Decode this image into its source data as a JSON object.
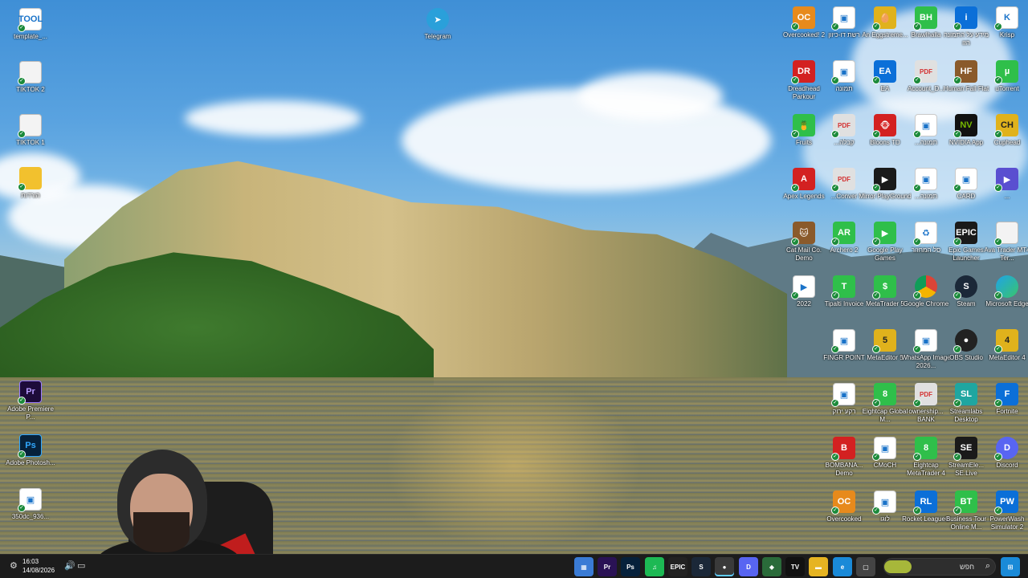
{
  "left_icons": [
    {
      "label": "template_...",
      "icon": "tool-icon",
      "glyph": "TOOL",
      "style": "g-doc"
    },
    {
      "label": "TIKTOK 2",
      "icon": "text-file-icon",
      "glyph": "",
      "style": "g-file"
    },
    {
      "label": "TIKTOK 1",
      "icon": "text-file-icon",
      "glyph": "",
      "style": "g-file"
    },
    {
      "label": "הורדות",
      "icon": "folder-icon",
      "glyph": "",
      "style": "g-folder"
    },
    {
      "label": "Adobe Premiere P...",
      "icon": "premiere-icon",
      "glyph": "Pr",
      "style": "g-pr"
    },
    {
      "label": "Adobe Photosh...",
      "icon": "photoshop-icon",
      "glyph": "Ps",
      "style": "g-ps"
    },
    {
      "label": "350dc_936...",
      "icon": "image-file-icon",
      "glyph": "▣",
      "style": "g-doc"
    }
  ],
  "telegram": {
    "label": "Telegram",
    "glyph": "➤"
  },
  "right_icons": [
    [
      {
        "label": "Overcooked! 2",
        "glyph": "OC",
        "style": "g-orange",
        "icon": "overcooked-icon"
      },
      {
        "label": "רשת דו-כיוון",
        "glyph": "▣",
        "style": "g-doc",
        "icon": "image-file-icon"
      },
      {
        "label": "An Eggstreme...",
        "glyph": "🥚",
        "style": "g-yellow",
        "icon": "egg-game-icon"
      },
      {
        "label": "Brawlhalla",
        "glyph": "BH",
        "style": "g-green",
        "icon": "brawlhalla-icon"
      },
      {
        "label": "מידע על התמונה הזו",
        "glyph": "i",
        "style": "g-blue",
        "icon": "info-icon"
      },
      {
        "label": "Krisp",
        "glyph": "K",
        "style": "g-doc",
        "icon": "krisp-icon"
      }
    ],
    [
      {
        "label": "Dreadhead Parkour",
        "glyph": "DR",
        "style": "g-red",
        "icon": "dreadhead-icon"
      },
      {
        "label": "תמונה",
        "glyph": "▣",
        "style": "g-doc",
        "icon": "image-file-icon"
      },
      {
        "label": "EA",
        "glyph": "EA",
        "style": "g-blue",
        "icon": "ea-icon"
      },
      {
        "label": "Account_D...",
        "glyph": "PDF",
        "style": "g-pdf",
        "icon": "pdf-icon"
      },
      {
        "label": "Human Fall Flat",
        "glyph": "HF",
        "style": "g-brown",
        "icon": "human-fall-flat-icon"
      },
      {
        "label": "uTorrent",
        "glyph": "µ",
        "style": "g-green",
        "icon": "utorrent-icon"
      }
    ],
    [
      {
        "label": "Fruits",
        "glyph": "🍍",
        "style": "g-green",
        "icon": "fruits-game-icon"
      },
      {
        "label": "...קבלה",
        "glyph": "PDF",
        "style": "g-pdf",
        "icon": "pdf-icon"
      },
      {
        "label": "Bloons TD",
        "glyph": "🐵",
        "style": "g-red",
        "icon": "bloons-icon"
      },
      {
        "label": "...תמונה",
        "glyph": "▣",
        "style": "g-doc",
        "icon": "image-file-icon"
      },
      {
        "label": "NVIDIA App",
        "glyph": "NV",
        "style": "g-nvidia",
        "icon": "nvidia-icon"
      },
      {
        "label": "Cuphead",
        "glyph": "CH",
        "style": "g-yellow",
        "icon": "cuphead-icon"
      }
    ],
    [
      {
        "label": "Apex Legends",
        "glyph": "A",
        "style": "g-red",
        "icon": "apex-icon"
      },
      {
        "label": "...Conver",
        "glyph": "PDF",
        "style": "g-pdf",
        "icon": "pdf-icon"
      },
      {
        "label": "Mirror PlayGround",
        "glyph": "▶",
        "style": "g-dark",
        "icon": "mirror-icon"
      },
      {
        "label": "...תמונה",
        "glyph": "▣",
        "style": "g-doc",
        "icon": "image-file-icon"
      },
      {
        "label": "CARD",
        "glyph": "▣",
        "style": "g-doc",
        "icon": "image-file-icon"
      },
      {
        "label": "...",
        "glyph": "▶",
        "style": "g-purple",
        "icon": "media-player-icon"
      }
    ],
    [
      {
        "label": "Cat Mail Co. Demo",
        "glyph": "🐱",
        "style": "g-brown",
        "icon": "cat-mail-icon"
      },
      {
        "label": "Archero 2",
        "glyph": "AR",
        "style": "g-green",
        "icon": "archero-icon"
      },
      {
        "label": "Google Play Games",
        "glyph": "▶",
        "style": "g-green",
        "icon": "google-play-icon"
      },
      {
        "label": "סל המחזור",
        "glyph": "♻",
        "style": "g-doc",
        "icon": "recycle-bin-icon"
      },
      {
        "label": "Epic Games Launcher",
        "glyph": "EPIC",
        "style": "g-dark",
        "icon": "epic-games-icon"
      },
      {
        "label": "Ava Trader MT4 Ter...",
        "glyph": "",
        "style": "g-file",
        "icon": "text-file-icon"
      }
    ],
    [
      {
        "label": "2022",
        "glyph": "▶",
        "style": "g-doc",
        "icon": "video-file-icon"
      },
      {
        "label": "Tipalti Invoice",
        "glyph": "T",
        "style": "g-green",
        "icon": "tipalti-icon"
      },
      {
        "label": "MetaTrader 5",
        "glyph": "$",
        "style": "g-green",
        "icon": "metatrader-icon"
      },
      {
        "label": "Google Chrome",
        "glyph": "",
        "style": "g-chrome",
        "icon": "chrome-icon"
      },
      {
        "label": "Steam",
        "glyph": "S",
        "style": "g-steam",
        "icon": "steam-icon"
      },
      {
        "label": "Microsoft Edge",
        "glyph": "",
        "style": "g-edge",
        "icon": "edge-icon"
      }
    ],
    [
      {
        "label": "FINGR POINT",
        "glyph": "▣",
        "style": "g-doc",
        "icon": "image-file-icon"
      },
      {
        "label": "MetaEditor 5",
        "glyph": "5",
        "style": "g-yellow",
        "icon": "metaeditor-icon"
      },
      {
        "label": "WhatsApp Image 2026...",
        "glyph": "▣",
        "style": "g-doc",
        "icon": "image-file-icon"
      },
      {
        "label": "OBS Studio",
        "glyph": "●",
        "style": "g-obs",
        "icon": "obs-icon"
      },
      {
        "label": "MetaEditor 4",
        "glyph": "4",
        "style": "g-yellow",
        "icon": "metaeditor-icon"
      }
    ],
    [
      {
        "label": "רקע ירוק",
        "glyph": "▣",
        "style": "g-doc",
        "icon": "image-file-icon"
      },
      {
        "label": "Eightcap Global M...",
        "glyph": "8",
        "style": "g-green",
        "icon": "eightcap-icon"
      },
      {
        "label": "ownership... BANK",
        "glyph": "PDF",
        "style": "g-pdf",
        "icon": "pdf-icon"
      },
      {
        "label": "Streamlabs Desktop",
        "glyph": "SL",
        "style": "g-cyan",
        "icon": "streamlabs-icon"
      },
      {
        "label": "Fortnite",
        "glyph": "F",
        "style": "g-blue",
        "icon": "fortnite-icon"
      }
    ],
    [
      {
        "label": "BOMBANA... Demo",
        "glyph": "B",
        "style": "g-red",
        "icon": "bombana-icon"
      },
      {
        "label": "CMoCH",
        "glyph": "▣",
        "style": "g-doc",
        "icon": "image-file-icon"
      },
      {
        "label": "Eightcap MetaTrader 4",
        "glyph": "8",
        "style": "g-green",
        "icon": "eightcap-icon"
      },
      {
        "label": "StreamEle... SE.Live",
        "glyph": "SE",
        "style": "g-dark",
        "icon": "streamelements-icon"
      },
      {
        "label": "Discord",
        "glyph": "D",
        "style": "g-discord",
        "icon": "discord-icon"
      }
    ],
    [
      {
        "label": "Overcooked",
        "glyph": "OC",
        "style": "g-orange",
        "icon": "overcooked-icon"
      },
      {
        "label": "לוגו",
        "glyph": "▣",
        "style": "g-doc",
        "icon": "image-file-icon"
      },
      {
        "label": "Rocket League®",
        "glyph": "RL",
        "style": "g-blue",
        "icon": "rocket-league-icon"
      },
      {
        "label": "Business Tour Online M...",
        "glyph": "BT",
        "style": "g-green",
        "icon": "business-tour-icon"
      },
      {
        "label": "PowerWash Simulator 2",
        "glyph": "PW",
        "style": "g-blue",
        "icon": "powerwash-icon"
      }
    ]
  ],
  "taskbar": {
    "time": "16:03",
    "date": "14/08/2026",
    "search_placeholder": "חפש",
    "apps": [
      {
        "name": "taskview",
        "glyph": "▦",
        "color": "#3a7bd5"
      },
      {
        "name": "premiere",
        "glyph": "Pr",
        "color": "#2a1255"
      },
      {
        "name": "photoshop",
        "glyph": "Ps",
        "color": "#06213b"
      },
      {
        "name": "spotify",
        "glyph": "♫",
        "color": "#1db954"
      },
      {
        "name": "epic-games",
        "glyph": "EPIC",
        "color": "#222"
      },
      {
        "name": "steam",
        "glyph": "S",
        "color": "#1b2838"
      },
      {
        "name": "obs",
        "glyph": "●",
        "color": "#3a3a3a"
      },
      {
        "name": "discord",
        "glyph": "D",
        "color": "#5865f2"
      },
      {
        "name": "streamelements",
        "glyph": "◆",
        "color": "#2a6b3a"
      },
      {
        "name": "tradingview",
        "glyph": "TV",
        "color": "#111"
      },
      {
        "name": "file-explorer",
        "glyph": "▬",
        "color": "#e6b422"
      },
      {
        "name": "edge",
        "glyph": "e",
        "color": "#1a8ad8"
      },
      {
        "name": "window",
        "glyph": "▢",
        "color": "#444"
      }
    ]
  }
}
